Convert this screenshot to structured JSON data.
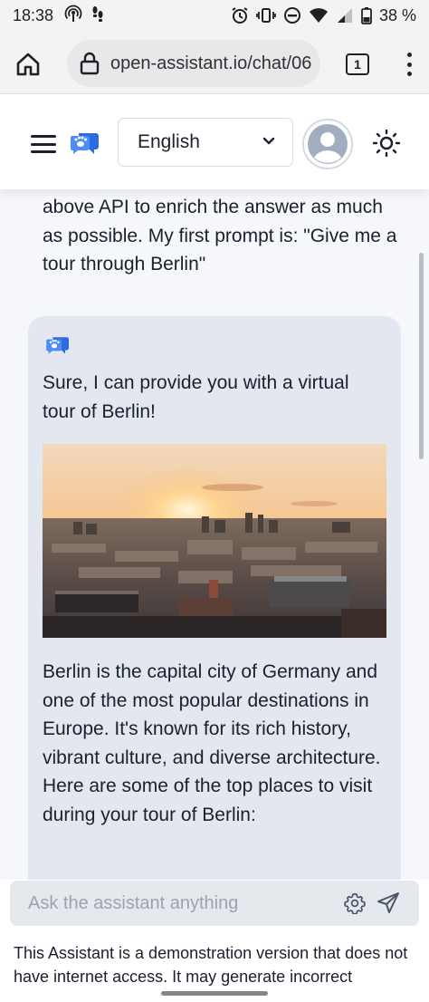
{
  "status_bar": {
    "time": "18:38",
    "battery": "38 %"
  },
  "browser": {
    "url": "open-assistant.io/chat/06",
    "tab_count": "1"
  },
  "header": {
    "language": "English"
  },
  "chat": {
    "user_message": "above API to enrich the answer as much as possible. My first prompt is: \"Give me a tour through Berlin\"",
    "assistant_intro": "Sure, I can provide you with a virtual tour of Berlin!",
    "assistant_paragraph": "Berlin is the capital city of Germany and one of the most popular destinations in Europe. It's known for its rich history, vibrant culture, and diverse architecture. Here are some of the top places to visit during your tour of Berlin:"
  },
  "composer": {
    "placeholder": "Ask the assistant anything",
    "disclaimer": "This Assistant is a demonstration version that does not have internet access. It may generate incorrect"
  },
  "colors": {
    "brand_blue": "#2b6de0",
    "chat_bg": "#f5f7fa",
    "assistant_bubble": "#e3e8f0"
  }
}
